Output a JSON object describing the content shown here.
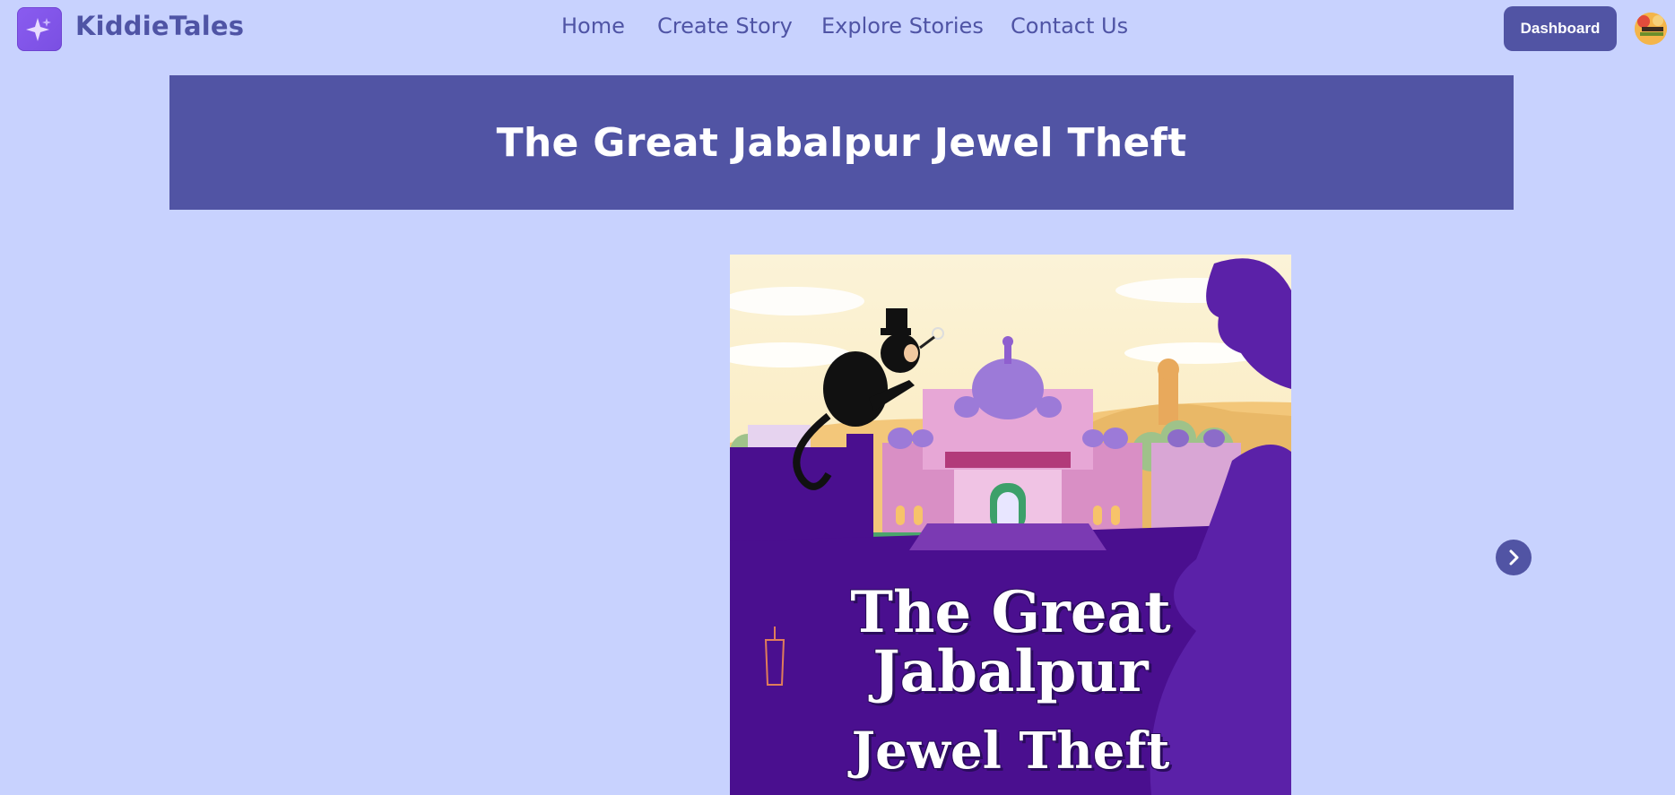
{
  "app": {
    "brand": "KiddieTales"
  },
  "nav": {
    "links": [
      {
        "label": "Home"
      },
      {
        "label": "Create Story"
      },
      {
        "label": "Explore Stories"
      },
      {
        "label": "Contact Us"
      }
    ],
    "dashboard_label": "Dashboard"
  },
  "story": {
    "title": "The Great Jabalpur Jewel Theft",
    "cover_title_lines": [
      "The Great",
      "Jabalpur",
      "Jewel Theft"
    ]
  },
  "colors": {
    "background": "#c8d2fe",
    "primary": "#5154a4",
    "brand_text": "#4f54a5",
    "logo": "#8a5cf0",
    "cover_purple": "#4a0f8f"
  },
  "icons": {
    "logo": "sparkle-icon",
    "next": "chevron-right-icon",
    "avatar": "user-avatar"
  }
}
